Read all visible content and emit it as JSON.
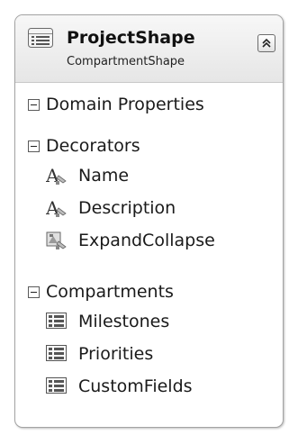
{
  "shape": {
    "title": "ProjectShape",
    "subtitle": "CompartmentShape",
    "header_icon": "compartment-shape-icon",
    "collapse_icon": "double-chevron-up-icon"
  },
  "sections": [
    {
      "label": "Domain Properties",
      "expanded": true,
      "items": []
    },
    {
      "label": "Decorators",
      "expanded": true,
      "items": [
        {
          "label": "Name",
          "icon": "text-decorator-icon"
        },
        {
          "label": "Description",
          "icon": "text-decorator-icon"
        },
        {
          "label": "ExpandCollapse",
          "icon": "expand-collapse-decorator-icon"
        }
      ]
    },
    {
      "label": "Compartments",
      "expanded": true,
      "items": [
        {
          "label": "Milestones",
          "icon": "compartment-icon"
        },
        {
          "label": "Priorities",
          "icon": "compartment-icon"
        },
        {
          "label": "CustomFields",
          "icon": "compartment-icon"
        }
      ]
    }
  ],
  "colors": {
    "border": "#a3a3a3",
    "header_top": "#f7f7f7",
    "header_bottom": "#e6e6e6",
    "text": "#1a1a1a"
  }
}
